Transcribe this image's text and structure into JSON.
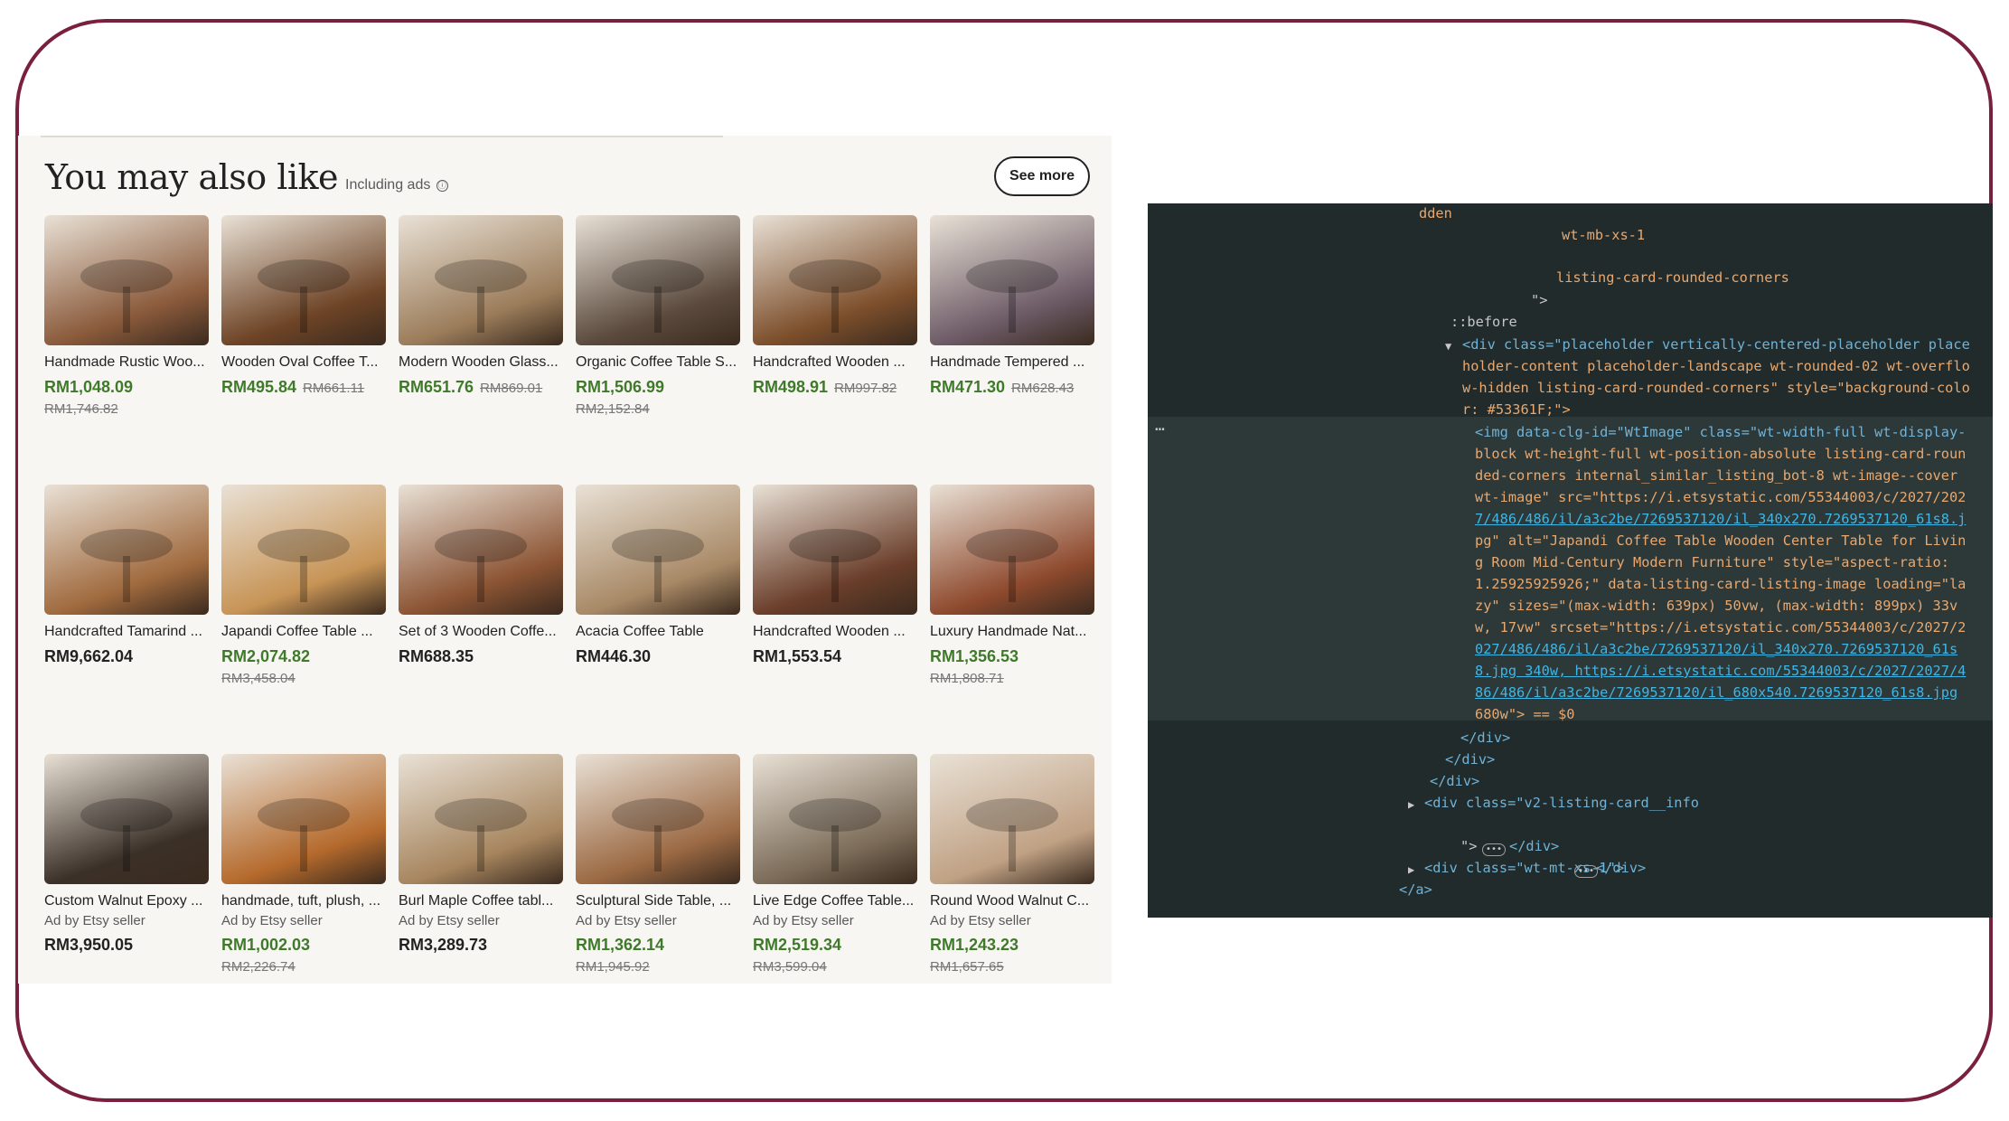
{
  "section": {
    "title": "You may also like",
    "subtitle": "Including ads",
    "info_icon": "ⓘ",
    "see_more_label": "See more"
  },
  "products": [
    {
      "name": "Handmade Rustic Woo...",
      "price": "RM1,048.09",
      "original": "RM1,746.82",
      "ad": "",
      "color": "#8a5a3b"
    },
    {
      "name": "Wooden Oval Coffee T...",
      "price": "RM495.84",
      "original": "RM661.11",
      "ad": "",
      "color": "#6e4426"
    },
    {
      "name": "Modern Wooden Glass...",
      "price": "RM651.76",
      "original": "RM869.01",
      "ad": "",
      "color": "#9b7c5a"
    },
    {
      "name": "Organic Coffee Table S...",
      "price": "RM1,506.99",
      "original": "RM2,152.84",
      "ad": "",
      "color": "#5b4a3d"
    },
    {
      "name": "Handcrafted Wooden ...",
      "price": "RM498.91",
      "original": "RM997.82",
      "ad": "",
      "color": "#7d4f2c"
    },
    {
      "name": "Handmade Tempered ...",
      "price": "RM471.30",
      "original": "RM628.43",
      "ad": "",
      "color": "#6c5a66"
    },
    {
      "name": "Handcrafted Tamarind ...",
      "price": "RM9,662.04",
      "original": "",
      "ad": "",
      "color": "#a06a3e"
    },
    {
      "name": "Japandi Coffee Table ...",
      "price": "RM2,074.82",
      "original": "RM3,458.04",
      "ad": "",
      "color": "#c79456"
    },
    {
      "name": "Set of 3 Wooden Coffe...",
      "price": "RM688.35",
      "original": "",
      "ad": "",
      "color": "#8c5434"
    },
    {
      "name": "Acacia Coffee Table",
      "price": "RM446.30",
      "original": "",
      "ad": "",
      "color": "#a88966"
    },
    {
      "name": "Handcrafted Wooden ...",
      "price": "RM1,553.54",
      "original": "",
      "ad": "",
      "color": "#6a3e2a"
    },
    {
      "name": "Luxury Handmade Nat...",
      "price": "RM1,356.53",
      "original": "RM1,808.71",
      "ad": "",
      "color": "#8e4a2e"
    },
    {
      "name": "Custom Walnut Epoxy ...",
      "price": "RM3,950.05",
      "original": "",
      "ad": "Ad by Etsy seller",
      "color": "#3b3028"
    },
    {
      "name": "handmade, tuft, plush, ...",
      "price": "RM1,002.03",
      "original": "RM2,226.74",
      "ad": "Ad by Etsy seller",
      "color": "#b56a2c"
    },
    {
      "name": "Burl Maple Coffee tabl...",
      "price": "RM3,289.73",
      "original": "",
      "ad": "Ad by Etsy seller",
      "color": "#a7865f"
    },
    {
      "name": "Sculptural Side Table, ...",
      "price": "RM1,362.14",
      "original": "RM1,945.92",
      "ad": "Ad by Etsy seller",
      "color": "#9c6a44"
    },
    {
      "name": "Live Edge Coffee Table...",
      "price": "RM2,519.34",
      "original": "RM3,599.04",
      "ad": "Ad by Etsy seller",
      "color": "#7b6b58"
    },
    {
      "name": "Round Wood Walnut C...",
      "price": "RM1,243.23",
      "original": "RM1,657.65",
      "ad": "Ad by Etsy seller",
      "color": "#c0a184"
    }
  ],
  "devtools": {
    "ellipsis": "…",
    "lines": [
      "dden",
      "wt-mb-xs-1",
      "listing-card-rounded-corners",
      "\">",
      "::before",
      "<div class=\"placeholder vertically-centered-placeholder place",
      "holder-content placeholder-landscape wt-rounded-02 wt-overflo",
      "w-hidden listing-card-rounded-corners\" style=\"background-colo",
      "r: #53361F;\">",
      "<img data-clg-id=\"WtImage\" class=\"wt-width-full wt-display-",
      "block wt-height-full wt-position-absolute listing-card-roun",
      "ded-corners internal_similar_listing_bot-8 wt-image--cover",
      "wt-image\" src=\"https://i.etsystatic.com/55344003/c/2027/202",
      "7/486/486/il/a3c2be/7269537120/il_340x270.7269537120_61s8.j",
      "pg\" alt=\"Japandi Coffee Table Wooden Center Table for Livin",
      "g Room Mid-Century Modern Furniture\" style=\"aspect-ratio:",
      "1.25925925926;\" data-listing-card-listing-image loading=\"la",
      "zy\" sizes=\"(max-width: 639px) 50vw, (max-width: 899px) 33v",
      "w, 17vw\" srcset=\"https://i.etsystatic.com/55344003/c/2027/2",
      "027/486/486/il/a3c2be/7269537120/il_340x270.7269537120_61s",
      "8.jpg 340w, https://i.etsystatic.com/55344003/c/2027/2027/4",
      "86/486/il/a3c2be/7269537120/il_680x540.7269537120_61s8.jpg",
      "680w\"> == $0",
      "</div>",
      "</div>",
      "</div>",
      "<div class=\"v2-listing-card__info",
      "\">",
      "</div>",
      "<div class=\"wt-mt-xs-1\">",
      "</div>",
      "</a>"
    ]
  }
}
